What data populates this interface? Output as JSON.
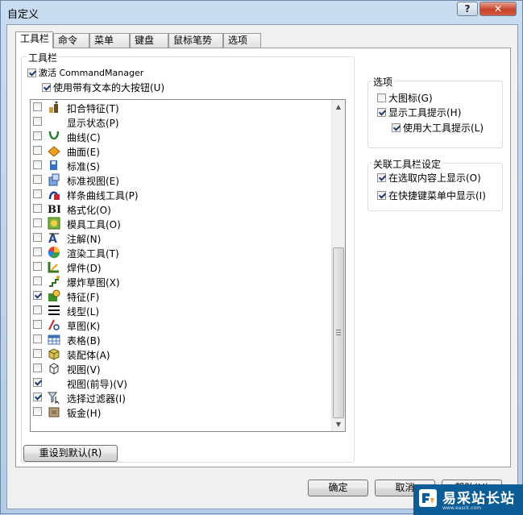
{
  "window": {
    "title": "自定义",
    "help": "?",
    "close": "✕"
  },
  "tabs": [
    "工具栏",
    "命令",
    "菜单",
    "键盘",
    "鼠标笔势",
    "选项"
  ],
  "toolbars": {
    "legend": "工具栏",
    "activate_cm": {
      "label": "激活 CommandManager",
      "checked": true
    },
    "large_buttons": {
      "label": "使用带有文本的大按钮(U)",
      "checked": true
    },
    "items": [
      {
        "label": "扣合特征(T)",
        "checked": false,
        "icon": "snap-feature-icon"
      },
      {
        "label": "显示状态(P)",
        "checked": false,
        "icon": ""
      },
      {
        "label": "曲线(C)",
        "checked": false,
        "icon": "curve-icon"
      },
      {
        "label": "曲面(E)",
        "checked": false,
        "icon": "surface-icon"
      },
      {
        "label": "标准(S)",
        "checked": false,
        "icon": "standard-icon"
      },
      {
        "label": "标准视图(E)",
        "checked": false,
        "icon": "standard-view-icon"
      },
      {
        "label": "样条曲线工具(P)",
        "checked": false,
        "icon": "spline-tool-icon"
      },
      {
        "label": "格式化(O)",
        "checked": false,
        "icon": "format-icon"
      },
      {
        "label": "模具工具(O)",
        "checked": false,
        "icon": "mold-tool-icon"
      },
      {
        "label": "注解(N)",
        "checked": false,
        "icon": "annotation-icon"
      },
      {
        "label": "渲染工具(T)",
        "checked": false,
        "icon": "render-tool-icon"
      },
      {
        "label": "焊件(D)",
        "checked": false,
        "icon": "weldment-icon"
      },
      {
        "label": "爆炸草图(X)",
        "checked": false,
        "icon": "explode-sketch-icon"
      },
      {
        "label": "特征(F)",
        "checked": true,
        "icon": "features-icon"
      },
      {
        "label": "线型(L)",
        "checked": false,
        "icon": "line-format-icon"
      },
      {
        "label": "草图(K)",
        "checked": false,
        "icon": "sketch-icon"
      },
      {
        "label": "表格(B)",
        "checked": false,
        "icon": "table-icon"
      },
      {
        "label": "装配体(A)",
        "checked": false,
        "icon": "assembly-icon"
      },
      {
        "label": "视图(V)",
        "checked": false,
        "icon": "view-icon"
      },
      {
        "label": "视图(前导)(V)",
        "checked": true,
        "icon": ""
      },
      {
        "label": "选择过滤器(I)",
        "checked": true,
        "icon": "selection-filter-icon"
      },
      {
        "label": "钣金(H)",
        "checked": false,
        "icon": "sheet-metal-icon"
      }
    ]
  },
  "options": {
    "legend": "选项",
    "large_icons": {
      "label": "大图标(G)",
      "checked": false
    },
    "show_tooltips": {
      "label": "显示工具提示(H)",
      "checked": true
    },
    "large_tooltips": {
      "label": "使用大工具提示(L)",
      "checked": true
    }
  },
  "context": {
    "legend": "关联工具栏设定",
    "on_selection": {
      "label": "在选取内容上显示(O)",
      "checked": true
    },
    "in_shortcut": {
      "label": "在快捷键菜单中显示(I)",
      "checked": true
    }
  },
  "buttons": {
    "reset": "重设到默认(R)",
    "ok": "确定",
    "cancel": "取消",
    "help": "帮助(H)"
  },
  "watermark": {
    "text": "易采站长站",
    "url": "www.easck.com"
  }
}
